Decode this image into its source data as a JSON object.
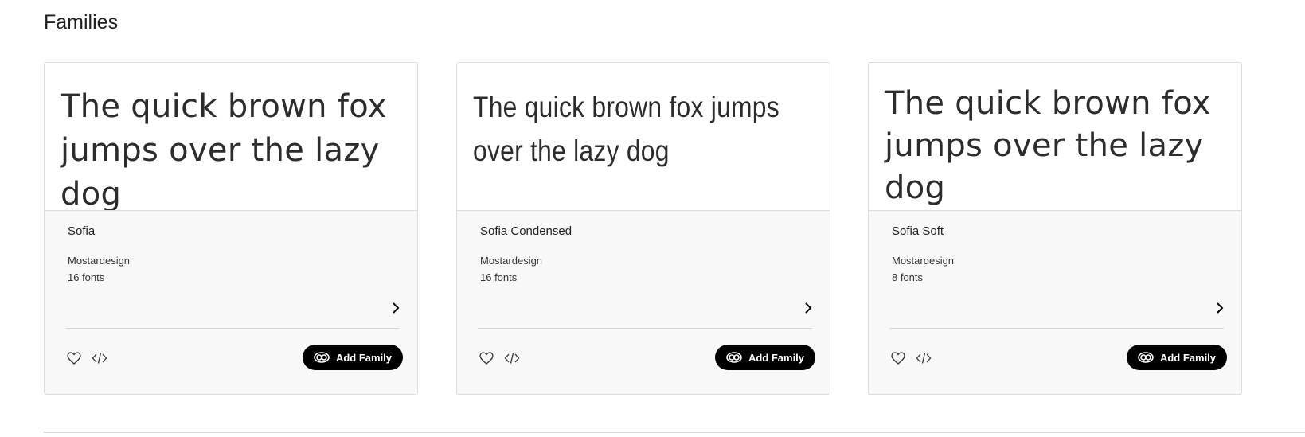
{
  "section": {
    "title": "Families"
  },
  "cards": [
    {
      "sample": "The quick brown fox jumps over the lazy dog",
      "name": "Sofia",
      "foundry": "Mostardesign",
      "count": "16 fonts",
      "add_label": "Add Family"
    },
    {
      "sample": "The quick brown fox jumps over the lazy dog",
      "name": "Sofia Condensed",
      "foundry": "Mostardesign",
      "count": "16 fonts",
      "add_label": "Add Family"
    },
    {
      "sample": "The quick brown fox jumps over the lazy dog",
      "name": "Sofia Soft",
      "foundry": "Mostardesign",
      "count": "8 fonts",
      "add_label": "Add Family"
    }
  ],
  "icons": {
    "favorite": "heart-icon",
    "embed": "code-icon",
    "details": "chevron-right-icon",
    "add": "creative-cloud-icon"
  },
  "colors": {
    "button_bg": "#000000",
    "button_text": "#ffffff",
    "card_bg": "#f8f8f8"
  }
}
